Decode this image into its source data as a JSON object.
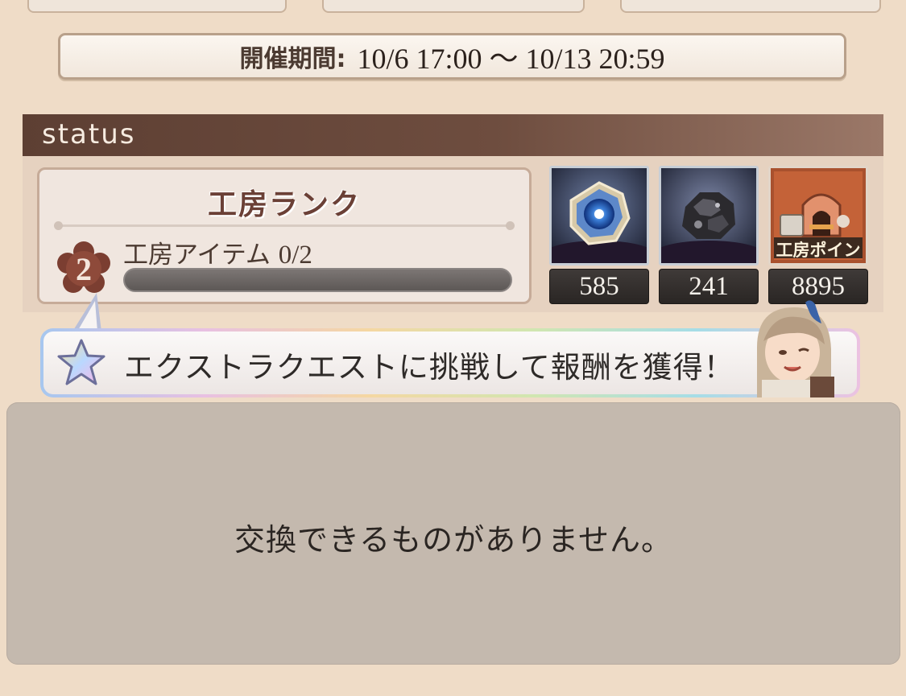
{
  "event_period": {
    "label": "開催期間:",
    "value": "10/6 17:00 〜 10/13 20:59"
  },
  "status": {
    "header": "status",
    "rank_card": {
      "title": "工房ランク",
      "rank": "2",
      "progress_label": "工房アイテム",
      "progress_value": "0/2",
      "progress_fraction": 0
    },
    "resources": [
      {
        "icon": "blue-gem-icon",
        "count": "585"
      },
      {
        "icon": "black-ore-icon",
        "count": "241"
      },
      {
        "icon": "workshop-point-icon",
        "icon_label": "工房ポイント",
        "count": "8895"
      }
    ]
  },
  "banner": {
    "text": "エクストラクエストに挑戦して報酬を獲得！"
  },
  "exchange": {
    "empty_message": "交換できるものがありません。"
  },
  "colors": {
    "background": "#efdcc7",
    "status_header": "#5d3f33",
    "exchange_panel": "#c4b9ae"
  }
}
